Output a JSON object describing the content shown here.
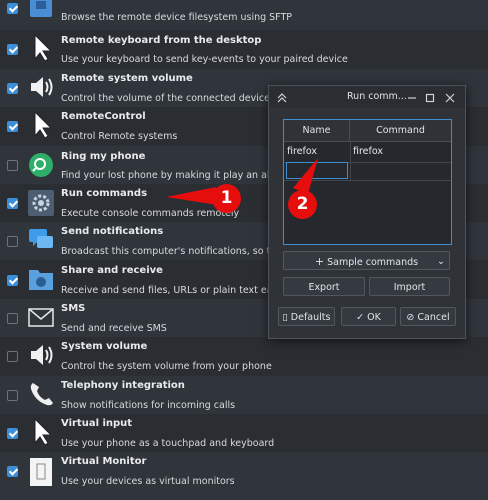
{
  "plugins": [
    {
      "title": "",
      "description": "Browse the remote device filesystem using SFTP",
      "checked": true,
      "icon": "folder-icon"
    },
    {
      "title": "Remote keyboard from the desktop",
      "description": "Use your keyboard to send key-events to your paired device",
      "checked": true,
      "icon": "cursor-icon"
    },
    {
      "title": "Remote system volume",
      "description": "Control the volume of the connected device",
      "checked": true,
      "icon": "speaker-icon"
    },
    {
      "title": "RemoteControl",
      "description": "Control Remote systems",
      "checked": true,
      "icon": "cursor-icon"
    },
    {
      "title": "Ring my phone",
      "description": "Find your lost phone by making it play an alarm sou",
      "checked": false,
      "icon": "search-icon"
    },
    {
      "title": "Run commands",
      "description": "Execute console commands remotely",
      "checked": true,
      "icon": "gear-icon"
    },
    {
      "title": "Send notifications",
      "description": "Broadcast this computer's notifications, so they can",
      "checked": false,
      "icon": "chat-icon"
    },
    {
      "title": "Share and receive",
      "description": "Receive and send files, URLs or plain text easily",
      "checked": true,
      "icon": "share-folder-icon"
    },
    {
      "title": "SMS",
      "description": "Send and receive SMS",
      "checked": false,
      "icon": "mail-icon"
    },
    {
      "title": "System volume",
      "description": "Control the system volume from your phone",
      "checked": false,
      "icon": "speaker-icon"
    },
    {
      "title": "Telephony integration",
      "description": "Show notifications for incoming calls",
      "checked": false,
      "icon": "phone-icon"
    },
    {
      "title": "Virtual input",
      "description": "Use your phone as a touchpad and keyboard",
      "checked": true,
      "icon": "cursor-icon"
    },
    {
      "title": "Virtual Monitor",
      "description": "Use your devices as virtual monitors",
      "checked": true,
      "icon": "monitor-icon"
    }
  ],
  "dialog": {
    "title": "Run comm...",
    "columns": {
      "name": "Name",
      "command": "Command"
    },
    "rows": [
      {
        "name": "firefox",
        "command": "firefox"
      }
    ],
    "sample_label": "Sample commands",
    "export_label": "Export",
    "import_label": "Import",
    "defaults_label": "Defaults",
    "ok_label": "OK",
    "cancel_label": "Cancel"
  },
  "annotations": {
    "one": "1",
    "two": "2"
  },
  "colors": {
    "accent": "#3b8fd8",
    "callout": "#e60d0d",
    "background": "#2b2f34"
  }
}
